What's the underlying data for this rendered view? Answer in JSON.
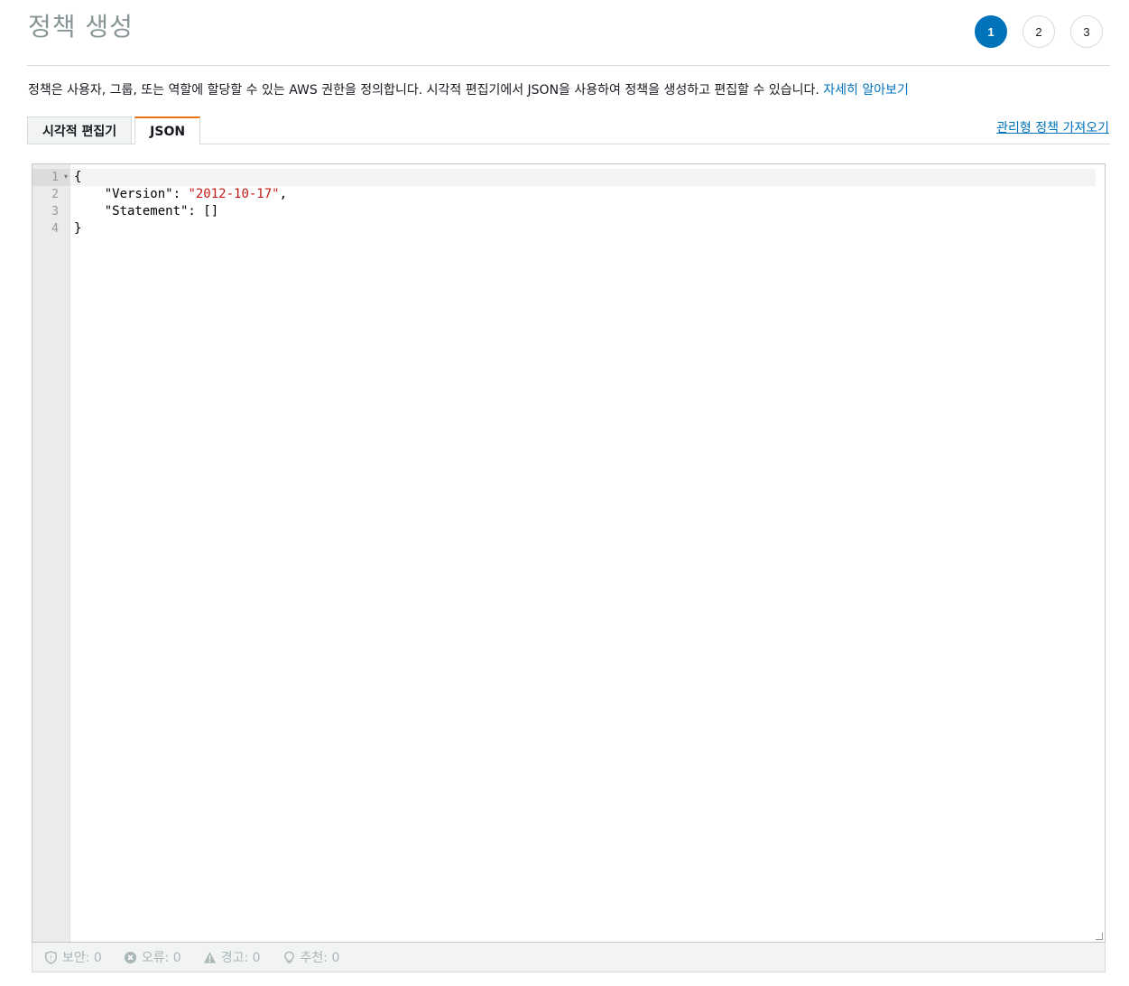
{
  "header": {
    "title": "정책 생성",
    "steps": [
      "1",
      "2",
      "3"
    ],
    "active_step": "1"
  },
  "description": {
    "text": "정책은 사용자, 그룹, 또는 역할에 할당할 수 있는 AWS 권한을 정의합니다. 시각적 편집기에서 JSON을 사용하여 정책을 생성하고 편집할 수 있습니다. ",
    "learn_more": "자세히 알아보기"
  },
  "tabs": [
    {
      "label": "시각적 편집기"
    },
    {
      "label": "JSON"
    }
  ],
  "import_link": "관리형 정책 가져오기",
  "editor": {
    "line_numbers": [
      "1",
      "2",
      "3",
      "4"
    ],
    "lines": {
      "l1": "{",
      "l2_key": "    \"Version\": ",
      "l2_val": "\"2012-10-17\"",
      "l2_end": ",",
      "l3": "    \"Statement\": []",
      "l4": "}"
    }
  },
  "status": {
    "security": "보안: 0",
    "errors": "오류: 0",
    "warnings": "경고: 0",
    "suggestions": "추천: 0"
  },
  "colors": {
    "accent": "#0073bb",
    "tab_accent": "#ec7211",
    "string": "#c41a16"
  }
}
